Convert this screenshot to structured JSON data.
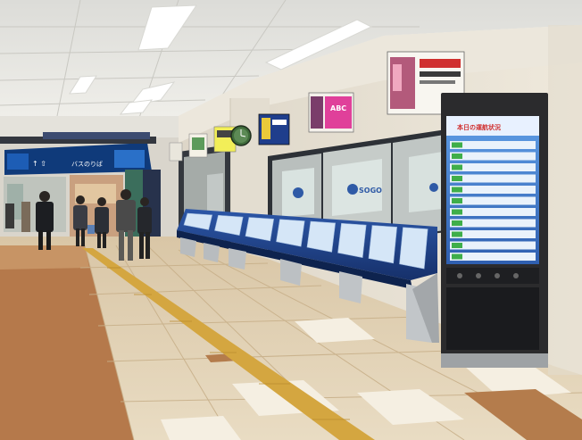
{
  "scene": {
    "overhead_sign_left": "バスのりば",
    "store_logo": "SOGO",
    "poster_abc_title": "ABC",
    "kiosk_header": "本日の運航状況",
    "panel_count": 8
  },
  "colors": {
    "ceiling": "#efeeea",
    "wall": "#e7e1d3",
    "floor_light": "#efe7d6",
    "floor_brown": "#b97f4f",
    "tactile_strip": "#d6a743",
    "console_blue": "#1f3f86",
    "kiosk_frame": "#2b2b2d",
    "screen_blue": "#3a72c4"
  }
}
